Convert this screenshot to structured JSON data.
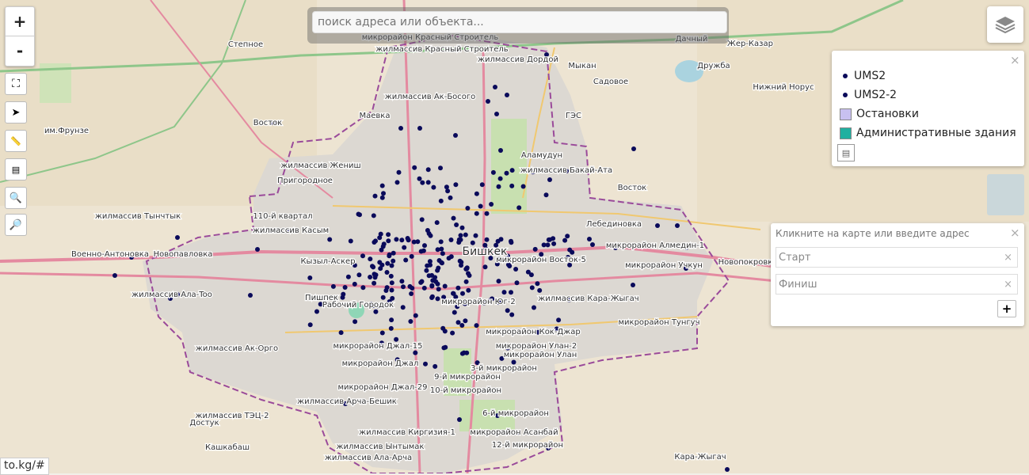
{
  "search": {
    "placeholder": "поиск адреса или объекта..."
  },
  "controls": {
    "zoom_in": "+",
    "zoom_out": "-"
  },
  "legend": {
    "items": [
      {
        "label": "UMS2",
        "kind": "dot",
        "color": "#0a0a5a"
      },
      {
        "label": "UMS2-2",
        "kind": "dot",
        "color": "#0a0a5a"
      },
      {
        "label": "Остановки",
        "kind": "square",
        "color": "#c8c0f0"
      },
      {
        "label": "Административные здания",
        "kind": "square",
        "color": "#20b0a0"
      }
    ],
    "close": "×"
  },
  "routing": {
    "hint": "Кликните на карте или введите адрес",
    "start_placeholder": "Старт",
    "finish_placeholder": "Финиш",
    "add": "+",
    "close": "×",
    "clear": "×"
  },
  "status_url": "to.kg/#",
  "colors": {
    "point": "#0a0a5a",
    "boundary": "#9a4a9a",
    "main_road": "#e48aa0",
    "secondary_road": "#f0c870",
    "green": "#c8e0b0"
  },
  "labels": [
    "микрорайон Красный Строитель",
    "жилмассив Красный Строитель",
    "жилмассив Дордой",
    "Степное",
    "Дачный",
    "Жер-Казар",
    "Мыкан",
    "Садовое",
    "Дружба",
    "Нижний Норус",
    "жилмассив Ак-Босого",
    "Маевка",
    "ГЭС",
    "им.Фрунзе",
    "Восток",
    "Аламудун",
    "жилмассив Бакай-Ата",
    "жилмассив Жениш",
    "Пригородное",
    "Восток",
    "110-й квартал",
    "жилмассив Тынчтык",
    "жилмассив Касым",
    "Лебединовка",
    "микрорайон Алмедин-1",
    "Военно-Антоновка",
    "Новопавловка",
    "Кызыл-Аскер",
    "Бишкек",
    "микрорайон Восток-5",
    "микрорайон Учкун",
    "Новопокровка",
    "жилмассив Ала-Too",
    "Пишпек",
    "Рабочий Городок",
    "микрорайон Юг-2",
    "жилмассив Кара-Жыгач",
    "микрорайон Тунгуч",
    "микрорайон Кок-Джар",
    "жилмассив Ак-Орго",
    "микрорайон Джал-15",
    "микрорайон Улан-2",
    "микрорайон Улан",
    "микрорайон Джал",
    "3-й микрорайон",
    "9-й микрорайон",
    "микрорайон Джал-29",
    "10-й микрорайон",
    "жилмассив Арча-Бешик",
    "6-й микрорайон",
    "жилмассив ТЭЦ-2",
    "Достук",
    "жилмассив Киргизия-1",
    "микрорайон Асанбай",
    "Кашкабаш",
    "жилмассив Ынтымак",
    "12-й микрорайон",
    "жилмассив Ала-Арча",
    "Кара-Жыгач"
  ]
}
